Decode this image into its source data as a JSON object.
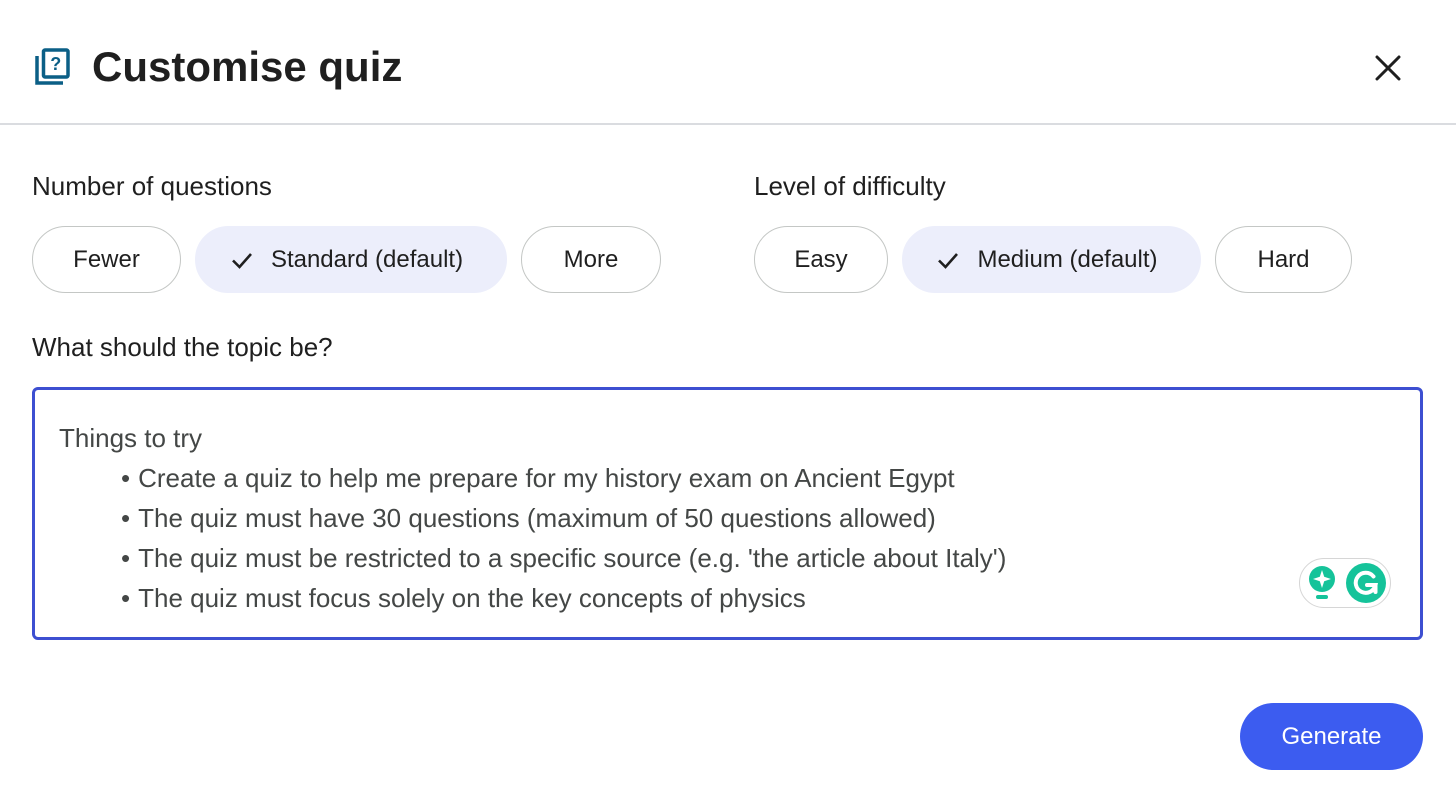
{
  "dialog": {
    "title": "Customise quiz",
    "icon": "quiz-icon",
    "close_icon": "close-icon"
  },
  "questions": {
    "label": "Number of questions",
    "options": [
      {
        "label": "Fewer",
        "selected": false
      },
      {
        "label": "Standard (default)",
        "selected": true
      },
      {
        "label": "More",
        "selected": false
      }
    ]
  },
  "difficulty": {
    "label": "Level of difficulty",
    "options": [
      {
        "label": "Easy",
        "selected": false
      },
      {
        "label": "Medium (default)",
        "selected": true
      },
      {
        "label": "Hard",
        "selected": false
      }
    ]
  },
  "topic": {
    "label": "What should the topic be?",
    "value": "",
    "placeholder_heading": "Things to try",
    "placeholder_items": [
      "Create a quiz to help me prepare for my history exam on Ancient Egypt",
      "The quiz must have 30 questions (maximum of 50 questions allowed)",
      "The quiz must be restricted to a specific source (e.g. 'the article about Italy')",
      "The quiz must focus solely on the key concepts of physics"
    ]
  },
  "grammarly": {
    "assist_icon": "lightbulb-assist-icon",
    "logo_icon": "grammarly-logo-icon"
  },
  "actions": {
    "generate_label": "Generate"
  },
  "colors": {
    "accent": "#3c5cf0",
    "focus_border": "#3d4fd1",
    "selected_chip": "#eceefb",
    "icon_teal": "#0b5f86",
    "grammarly_green": "#15c39a"
  }
}
